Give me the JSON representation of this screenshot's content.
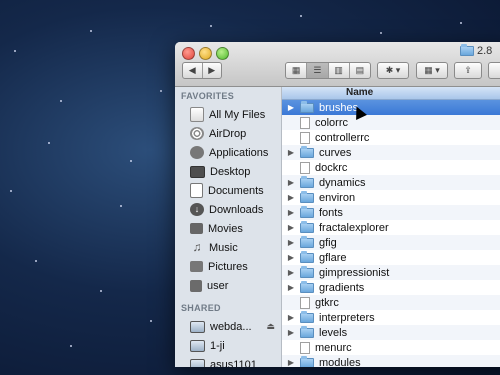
{
  "window": {
    "title": "2.8"
  },
  "toolbar": {
    "back_forward": [
      "◀",
      "▶"
    ],
    "view_buttons": [
      "grid-view-icon",
      "list-view-icon",
      "column-view-icon",
      "cover-flow-icon"
    ],
    "action_label": "✱ ▾",
    "arrange_label": "▦ ▾",
    "share_label": "⇪"
  },
  "sidebar": {
    "favorites_header": "FAVORITES",
    "favorites": [
      {
        "label": "All My Files",
        "icon": "all-files-icon"
      },
      {
        "label": "AirDrop",
        "icon": "airdrop-icon"
      },
      {
        "label": "Applications",
        "icon": "applications-icon"
      },
      {
        "label": "Desktop",
        "icon": "desktop-icon"
      },
      {
        "label": "Documents",
        "icon": "documents-icon"
      },
      {
        "label": "Downloads",
        "icon": "downloads-icon"
      },
      {
        "label": "Movies",
        "icon": "movies-icon"
      },
      {
        "label": "Music",
        "icon": "music-icon"
      },
      {
        "label": "Pictures",
        "icon": "pictures-icon"
      },
      {
        "label": "user",
        "icon": "home-icon"
      }
    ],
    "shared_header": "SHARED",
    "shared": [
      {
        "label": "webda...",
        "icon": "computer-icon",
        "eject": "⏏"
      },
      {
        "label": "1-ji",
        "icon": "computer-icon"
      },
      {
        "label": "asus1101",
        "icon": "computer-icon"
      }
    ]
  },
  "list": {
    "column_header": "Name",
    "selected": "brushes",
    "rows": [
      {
        "name": "brushes",
        "type": "folder"
      },
      {
        "name": "colorrc",
        "type": "file"
      },
      {
        "name": "controllerrc",
        "type": "file"
      },
      {
        "name": "curves",
        "type": "folder"
      },
      {
        "name": "dockrc",
        "type": "file"
      },
      {
        "name": "dynamics",
        "type": "folder"
      },
      {
        "name": "environ",
        "type": "folder"
      },
      {
        "name": "fonts",
        "type": "folder"
      },
      {
        "name": "fractalexplorer",
        "type": "folder"
      },
      {
        "name": "gfig",
        "type": "folder"
      },
      {
        "name": "gflare",
        "type": "folder"
      },
      {
        "name": "gimpressionist",
        "type": "folder"
      },
      {
        "name": "gradients",
        "type": "folder"
      },
      {
        "name": "gtkrc",
        "type": "file"
      },
      {
        "name": "interpreters",
        "type": "folder"
      },
      {
        "name": "levels",
        "type": "folder"
      },
      {
        "name": "menurc",
        "type": "file"
      },
      {
        "name": "modules",
        "type": "folder"
      }
    ]
  },
  "colors": {
    "selection": "#3b78d6",
    "sidebar_bg": "#dde3ea",
    "header_bg": "#a9c6ea"
  }
}
